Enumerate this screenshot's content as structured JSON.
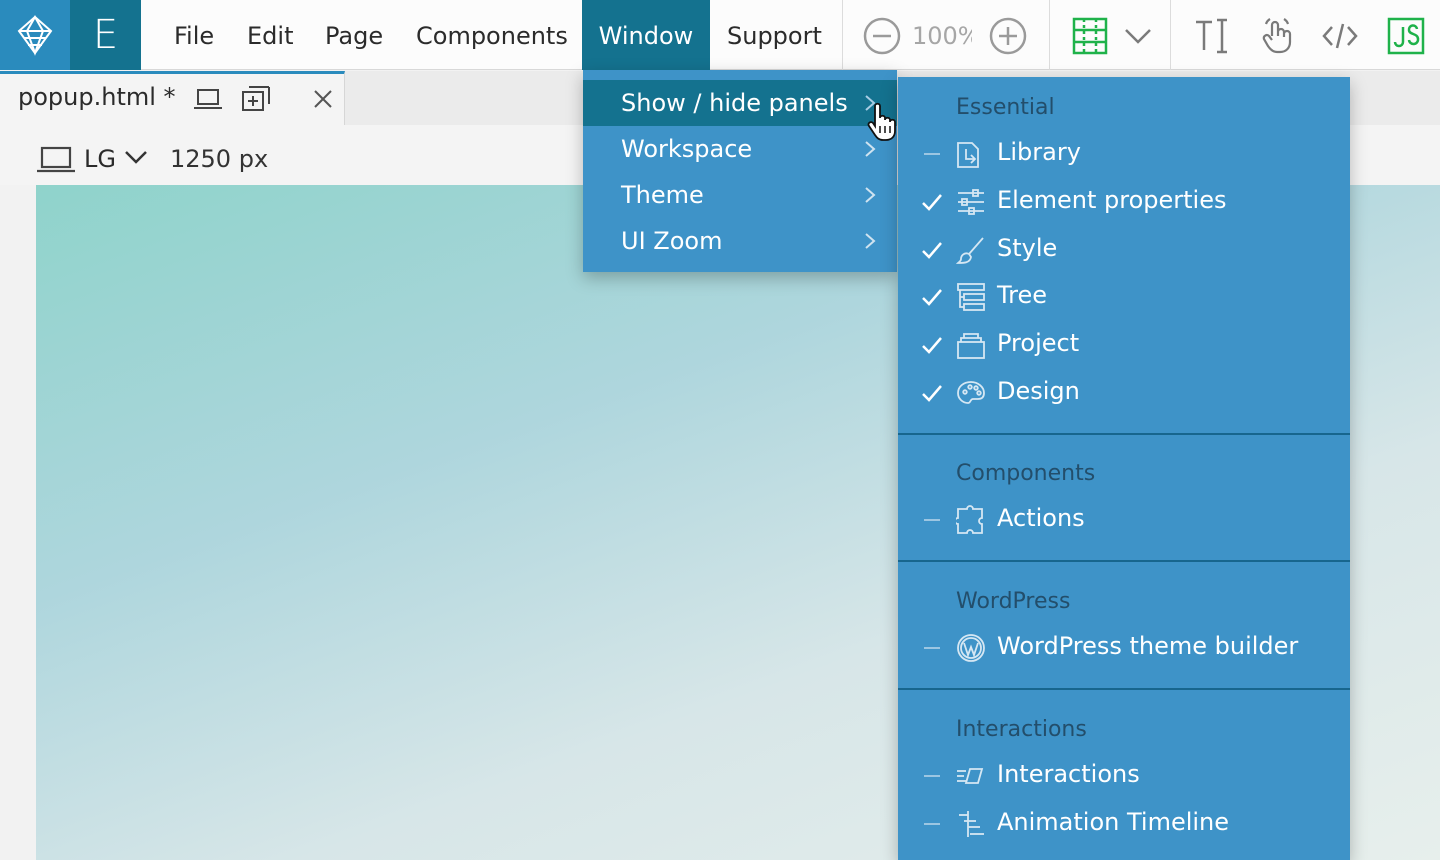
{
  "menubar": {
    "items": [
      "File",
      "Edit",
      "Page",
      "Components",
      "Window",
      "Support"
    ],
    "active": "Window"
  },
  "toolbar": {
    "zoom_value": "100%",
    "icons": [
      "zoom-out-icon",
      "zoom-in-icon",
      "layout-grid-icon",
      "chevron-down-icon",
      "text-cursor-icon",
      "interactions-hand-icon",
      "code-icon",
      "js-icon"
    ]
  },
  "tab": {
    "title": "popup.html *"
  },
  "device": {
    "label": "LG",
    "width": "1250 px"
  },
  "window_menu": {
    "items": [
      {
        "label": "Show / hide panels",
        "highlighted": true
      },
      {
        "label": "Workspace"
      },
      {
        "label": "Theme"
      },
      {
        "label": "UI Zoom"
      }
    ]
  },
  "panels_menu": {
    "groups": [
      {
        "title": "Essential",
        "items": [
          {
            "label": "Library",
            "checked": false,
            "icon": "library-icon"
          },
          {
            "label": "Element properties",
            "checked": true,
            "icon": "sliders-icon"
          },
          {
            "label": "Style",
            "checked": true,
            "icon": "brush-icon"
          },
          {
            "label": "Tree",
            "checked": true,
            "icon": "tree-icon"
          },
          {
            "label": "Project",
            "checked": true,
            "icon": "project-icon"
          },
          {
            "label": "Design",
            "checked": true,
            "icon": "palette-icon"
          }
        ]
      },
      {
        "title": "Components",
        "items": [
          {
            "label": "Actions",
            "checked": false,
            "icon": "puzzle-icon"
          }
        ]
      },
      {
        "title": "WordPress",
        "items": [
          {
            "label": "WordPress theme builder",
            "checked": false,
            "icon": "wordpress-icon"
          }
        ]
      },
      {
        "title": "Interactions",
        "items": [
          {
            "label": "Interactions",
            "checked": false,
            "icon": "interactions-icon"
          },
          {
            "label": "Animation Timeline",
            "checked": false,
            "icon": "timeline-icon"
          }
        ]
      }
    ]
  },
  "colors": {
    "brand_blue": "#2a8bbd",
    "brand_dark": "#14728f",
    "menu_bg": "#3e93c8",
    "js_green": "#1fb24a"
  }
}
